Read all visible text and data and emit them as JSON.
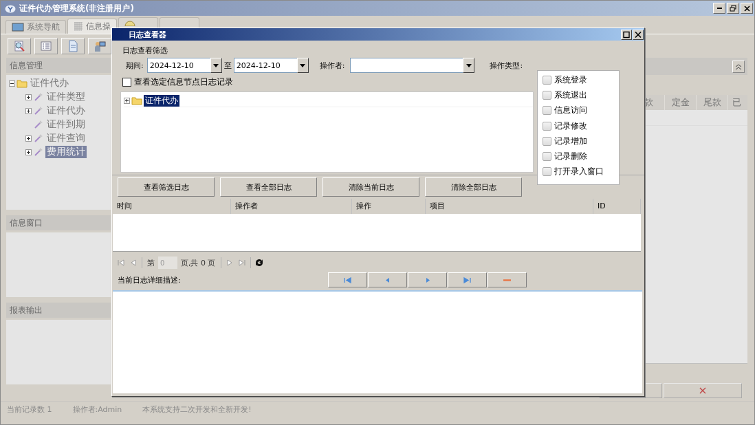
{
  "window": {
    "title": "证件代办管理系统(非注册用户)"
  },
  "tabs": [
    {
      "label": "系统导航",
      "kind": "monitor",
      "selected": false
    },
    {
      "label": "信息操",
      "kind": "grid",
      "selected": true
    },
    {
      "kind": "help",
      "selected": false
    },
    {
      "kind": "none",
      "selected": false
    }
  ],
  "toolbar": [
    {
      "kind": "search"
    },
    {
      "kind": "list"
    },
    {
      "kind": "document"
    },
    {
      "kind": "user"
    }
  ],
  "sidebar": {
    "sections": [
      {
        "title": "信息管理",
        "tree": [
          {
            "label": "证件代办",
            "kind": "folder",
            "expanded": true,
            "selected": false,
            "children": [
              {
                "label": "证件类型",
                "kind": "node",
                "expanded": false,
                "selected": false
              },
              {
                "label": "证件代办",
                "kind": "node",
                "expanded": false,
                "selected": false
              },
              {
                "label": "证件到期",
                "kind": "leaf",
                "expanded": false,
                "selected": false
              },
              {
                "label": "证件查询",
                "kind": "node",
                "expanded": false,
                "selected": false
              },
              {
                "label": "费用统计",
                "kind": "node",
                "expanded": false,
                "selected": true
              }
            ]
          }
        ]
      },
      {
        "title": "信息窗口"
      },
      {
        "title": "报表输出"
      }
    ]
  },
  "main": {
    "columns": [
      "款",
      "定金",
      "尾款",
      "已"
    ],
    "buttons": [
      {
        "kind": "blank"
      },
      {
        "kind": "delete",
        "label": "×"
      }
    ]
  },
  "status_bar": [
    "当前记录数 1",
    "操作者:Admin",
    "本系统支持二次开发和全新开发!"
  ],
  "dialog": {
    "title": "日志查看器",
    "filter": {
      "title": "日志查看筛选",
      "period_label": "期间:",
      "date_from": "2024-12-10",
      "to_label": "至",
      "date_to": "2024-12-10",
      "operator_label": "操作者:",
      "operation_type_label": "操作类型:",
      "node_filter": {
        "label": "查看选定信息节点日志记录",
        "checked": false
      },
      "tree": [
        {
          "label": "证件代办",
          "expanded": false,
          "selected": true
        }
      ],
      "operation_types": [
        {
          "label": "系统登录",
          "checked": false
        },
        {
          "label": "系统退出",
          "checked": false
        },
        {
          "label": "信息访问",
          "checked": false
        },
        {
          "label": "记录修改",
          "checked": false
        },
        {
          "label": "记录增加",
          "checked": false
        },
        {
          "label": "记录删除",
          "checked": false
        },
        {
          "label": "打开录入窗口",
          "checked": false
        }
      ]
    },
    "buttons": [
      "查看筛选日志",
      "查看全部日志",
      "清除当前日志",
      "清除全部日志"
    ],
    "log_table": {
      "columns": [
        "时间",
        "操作者",
        "操作",
        "项目",
        "ID"
      ]
    },
    "pager": {
      "page_prefix": "第",
      "page": "0",
      "page_suffix": "页,共 0 页",
      "nav": [
        {
          "kind": "first",
          "disabled": true
        },
        {
          "kind": "prev",
          "disabled": true
        },
        {
          "kind": "next",
          "disabled": true
        },
        {
          "kind": "last",
          "disabled": true
        }
      ]
    },
    "detail": {
      "label": "当前日志详细描述:",
      "nav": [
        {
          "kind": "first"
        },
        {
          "kind": "prev"
        },
        {
          "kind": "next"
        },
        {
          "kind": "last"
        },
        {
          "kind": "delete"
        }
      ]
    }
  }
}
